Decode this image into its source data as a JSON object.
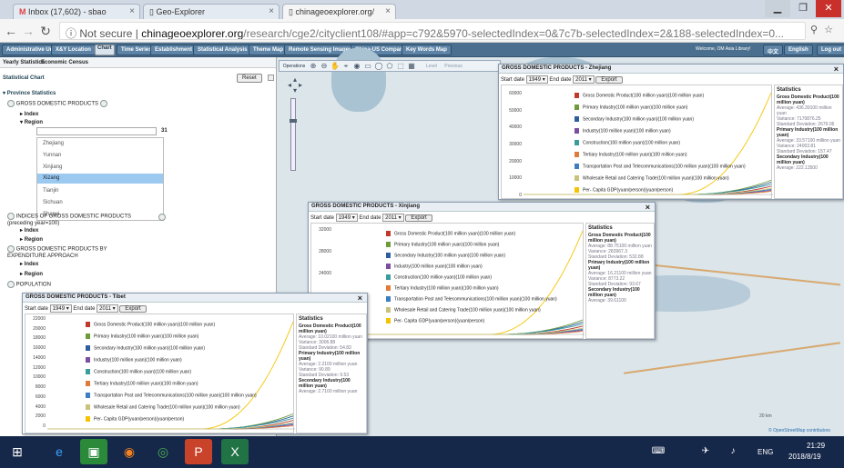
{
  "browser": {
    "tabs": [
      {
        "icon": "M",
        "title": "Inbox (17,602) - sbao "
      },
      {
        "icon": "",
        "title": "Geo-Explorer"
      },
      {
        "icon": "",
        "title": "chinageoexplorer.org/"
      }
    ],
    "not_secure": "Not secure",
    "url_host": "chinageoexplorer.org",
    "url_path": "/research/cge2/cityclient108/#app=c792&5970-selectedIndex=0&7c7b-selectedIndex=2&188-selectedIndex=0..."
  },
  "menu": {
    "items": [
      "Administrative Unit",
      "X&Y Location",
      "Chart",
      "Time Series",
      "Establishment",
      "Statistical Analysis",
      "Theme Map",
      "Remote Sensing Images",
      "China-US Compare",
      "Key Words Map"
    ],
    "welcome": "Welcome, OM Asia Library!",
    "lang1": "中文",
    "lang2": "English",
    "logout": "Log out"
  },
  "left_panel": {
    "tabs": [
      "Yearly Statistics",
      "Economic Census"
    ],
    "section": "Statistical Chart",
    "reset": "Reset",
    "group": "Province Statistics",
    "item1": "GROSS DOMESTIC PRODUCTS",
    "index": "Index",
    "region": "Region",
    "count": "31",
    "regions": [
      "Zhejiang",
      "Yunnan",
      "Xinjiang",
      "Xizang",
      "Tianjin",
      "Sichuan",
      "Shanxi"
    ],
    "selected_region": "Xizang",
    "item2": "INDICES OF GROSS DOMESTIC PRODUCTS (preceding year=100)",
    "item3": "GROSS DOMESTIC PRODUCTS BY EXPENDITURE APPROACH",
    "item4": "POPULATION",
    "index2": "Index",
    "region2": "Region",
    "index3": "Index",
    "region3": "Region"
  },
  "map": {
    "toolbar_label": "Operations",
    "toolbar_extra": [
      "Level",
      "Previous"
    ],
    "attribution": "© OpenStreetMap contributors",
    "label_city": "Tianjin",
    "scale_label": "20 km"
  },
  "series_names": [
    "Gross Domestic Product(100 million yuan)(100 million yuan)",
    "Primary Industry(100 million yuan)(100 million yuan)",
    "Secondary Industry(100 million yuan)(100 million yuan)",
    "Industry(100 million yuan)(100 million yuan)",
    "Construction(100 million yuan)(100 million yuan)",
    "Tertiary Industry(100 million yuan)(100 million yuan)",
    "Transportation Post and Telecommunications(100 million yuan)(100 million yuan)",
    "Wholesale Retail and Catering Trade(100 million yuan)(100 million yuan)",
    "Per- Capita GDP(yuan/person)(yuan/person)"
  ],
  "series_colors": [
    "#c0392b",
    "#6d9d3a",
    "#2e5e9e",
    "#7b4ea0",
    "#3b9c9c",
    "#e07b39",
    "#3c7ec0",
    "#c9c27a",
    "#f5c400"
  ],
  "controls": {
    "start_label": "Start date",
    "end_label": "End date",
    "start": "1949",
    "end": "2011",
    "export": "Export",
    "stats_title": "Statistics"
  },
  "windows": [
    {
      "title": "GROSS DOMESTIC PRODUCTS - Zhejiang",
      "yticks": [
        "60000",
        "50000",
        "40000",
        "30000",
        "20000",
        "10000",
        "0"
      ],
      "stats": [
        {
          "k": "Gross Domestic Product(100 million yuan)",
          "b": true
        },
        {
          "k": "Average: 436.39100 million yuan"
        },
        {
          "k": "Variance: 7170876.25"
        },
        {
          "k": "Standard Deviation: 2679.06"
        },
        {
          "k": "Primary Industry(100 million yuan)",
          "b": true
        },
        {
          "k": "Average: 33.57100 million yuan"
        },
        {
          "k": "Variance: 24003.81"
        },
        {
          "k": "Standard Deviation: 157.47"
        },
        {
          "k": "Secondary Industry(100 million yuan)",
          "b": true
        },
        {
          "k": "Average: 222.13500"
        }
      ]
    },
    {
      "title": "GROSS DOMESTIC PRODUCTS - Xinjiang",
      "yticks": [
        "32000",
        "28000",
        "24000",
        "20000",
        "16000"
      ],
      "stats": [
        {
          "k": "Gross Domestic Product(100 million yuan)",
          "b": true
        },
        {
          "k": "Average: 88.75100 million yuan"
        },
        {
          "k": "Variance: 283967.3"
        },
        {
          "k": "Standard Deviation: 532.88"
        },
        {
          "k": "Primary Industry(100 million yuan)",
          "b": true
        },
        {
          "k": "Average: 16.21100 million yuan"
        },
        {
          "k": "Variance: 8773.22"
        },
        {
          "k": "Standard Deviation: 93.67"
        },
        {
          "k": "Secondary Industry(100 million yuan)",
          "b": true
        },
        {
          "k": "Average: 39.61100"
        }
      ]
    },
    {
      "title": "GROSS DOMESTIC PRODUCTS - Tibet",
      "yticks": [
        "22000",
        "20000",
        "18000",
        "16000",
        "14000",
        "12000",
        "10000",
        "8000",
        "6000",
        "4000",
        "2000",
        "0"
      ],
      "stats": [
        {
          "k": "Gross Domestic Product(100 million yuan)",
          "b": true
        },
        {
          "k": "Average: 10.02100 million yuan"
        },
        {
          "k": "Variance: 3006.88"
        },
        {
          "k": "Standard Deviation: 54.83"
        },
        {
          "k": "Primary Industry(100 million yuan)",
          "b": true
        },
        {
          "k": "Average: 2.2100 million yuan"
        },
        {
          "k": "Variance: 90.89"
        },
        {
          "k": "Standard Deviation: 9.53"
        },
        {
          "k": "Secondary Industry(100 million yuan)",
          "b": true
        },
        {
          "k": "Average: 2.7100 million yuan"
        }
      ]
    }
  ],
  "taskbar": {
    "ime": "ENG",
    "time": "21:29",
    "date": "2018/8/19"
  }
}
